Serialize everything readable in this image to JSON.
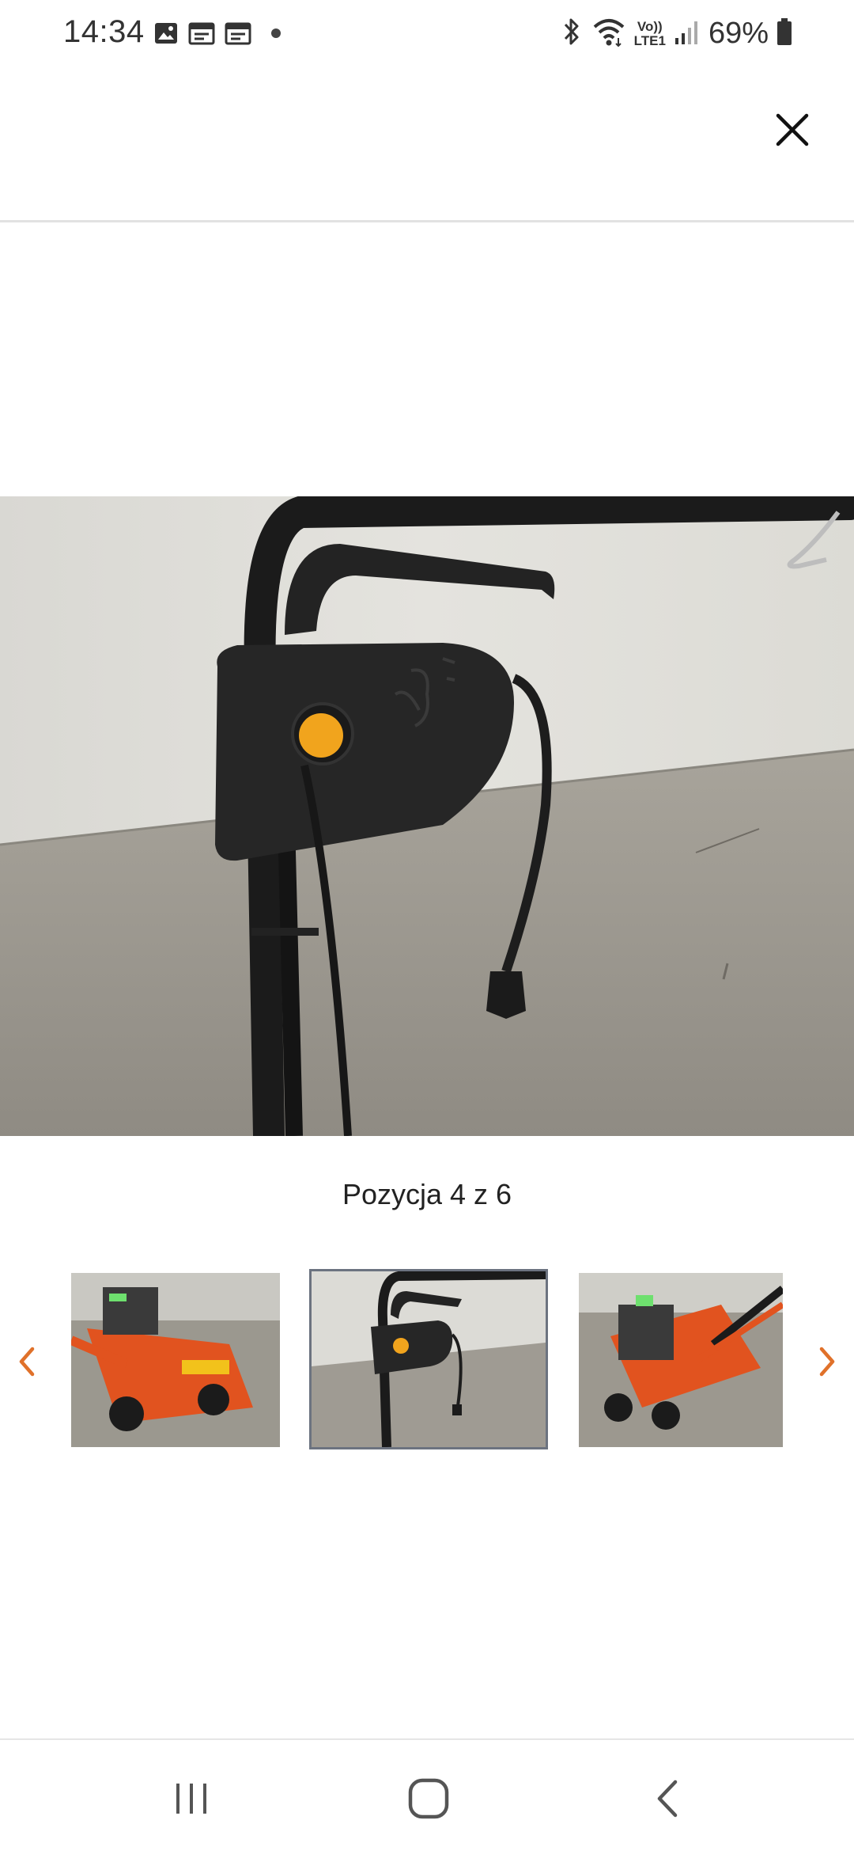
{
  "status_bar": {
    "time": "14:34",
    "battery_percent": "69%",
    "battery_level": 0.69,
    "icons_left": [
      "gallery-icon",
      "calendar-icon",
      "calendar-icon",
      "dot-icon"
    ],
    "icons_right": [
      "bluetooth-icon",
      "wifi-icon",
      "volte-icon",
      "signal-icon",
      "battery-icon"
    ],
    "volte_label_top": "Vo))",
    "volte_label_bottom": "LTE1"
  },
  "viewer": {
    "caption": "Pozycja 4 z 6",
    "close_icon": "close-icon"
  },
  "thumbnails": [
    {
      "name": "thumbnail-1",
      "selected": false
    },
    {
      "name": "thumbnail-2",
      "selected": true
    },
    {
      "name": "thumbnail-3",
      "selected": false
    }
  ],
  "navigation": {
    "prev_icon": "chevron-left-icon",
    "next_icon": "chevron-right-icon"
  },
  "nav_bar": {
    "icons": [
      "recent-apps-icon",
      "home-icon",
      "back-icon"
    ]
  },
  "colors": {
    "accent": "#e0712a",
    "divider": "#e2e2e2",
    "selected_border": "#6c7380"
  }
}
